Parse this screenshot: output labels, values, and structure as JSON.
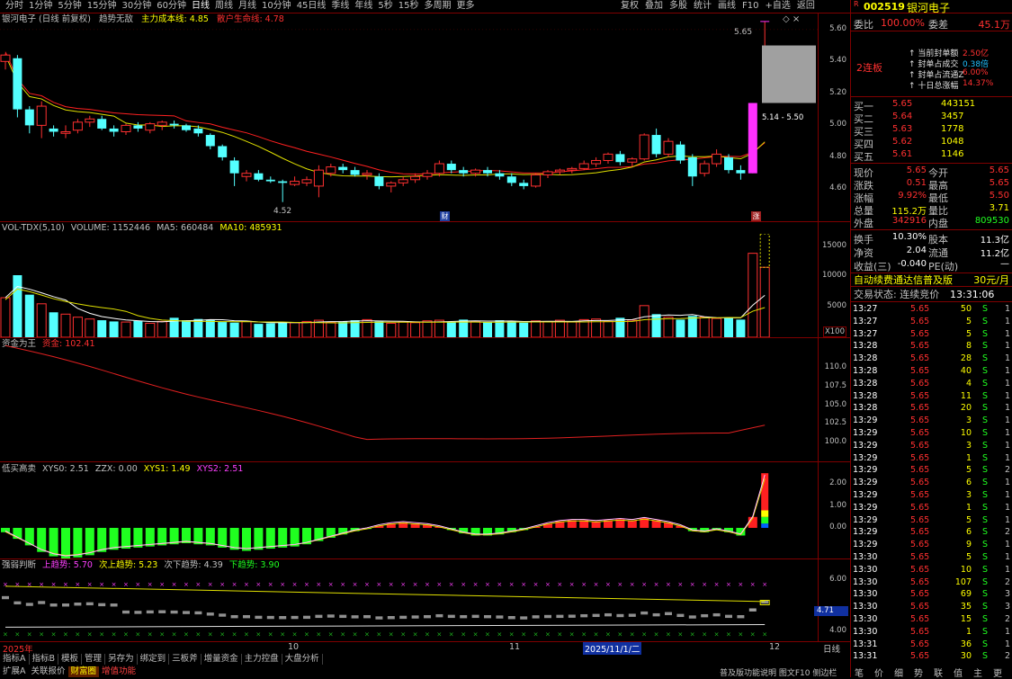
{
  "toolbar": {
    "periods": [
      "分时",
      "1分钟",
      "5分钟",
      "15分钟",
      "30分钟",
      "60分钟",
      "日线",
      "周线",
      "月线",
      "10分钟",
      "45日线",
      "季线",
      "年线",
      "5秒",
      "15秒",
      "多周期",
      "更多"
    ],
    "active_index": 6,
    "right_buttons": [
      "复权",
      "叠加",
      "多股",
      "统计",
      "画线",
      "F10",
      "+自选",
      "返回"
    ]
  },
  "main_header": {
    "name": "银河电子 (日线 前复权)",
    "indicator": "趋势无敌",
    "l1": "主力成本线: 4.85",
    "l2": "散户生命线: 4.78"
  },
  "main_axis": [
    "5.60",
    "5.40",
    "5.20",
    "5.00",
    "4.80",
    "4.60"
  ],
  "annot": {
    "high": "5.65",
    "low": "4.52",
    "range": "5.14 - 5.50",
    "cai": "财",
    "zhang": "涨"
  },
  "vol_header": {
    "name": "VOL-TDX(5,10)",
    "volume": "VOLUME: 1152446",
    "ma5": "MA5: 660484",
    "ma10": "MA10: 485931"
  },
  "vol_axis": [
    "15000",
    "10000",
    "5000"
  ],
  "vol_unit": "X100",
  "cap_header": {
    "name": "资金为王",
    "label": "资金: 102.41"
  },
  "cap_axis": [
    "110.0",
    "107.5",
    "105.0",
    "102.5",
    "100.0"
  ],
  "low_header": {
    "name": "低买高卖",
    "xys0": "XYS0: 2.51",
    "zzx": "ZZX: 0.00",
    "xys1": "XYS1: 1.49",
    "xys2": "XYS2: 2.51"
  },
  "low_axis": [
    "2.00",
    "1.00",
    "0.00"
  ],
  "strong_header": {
    "name": "强弱判断",
    "a": "上趋势: 5.70",
    "b": "次上趋势: 5.23",
    "c": "次下趋势: 4.39",
    "d": "下趋势: 3.90"
  },
  "strong_axis": [
    "6.00",
    "4.00"
  ],
  "strong_tag": "4.71",
  "date_axis": {
    "d1": "2025年",
    "d2": "10",
    "d3": "11",
    "d4": "2025/11/1/二",
    "d5": "12",
    "right": "日线"
  },
  "bottom_tabs": [
    "指标A",
    "指标B",
    "模板",
    "管理",
    "另存为",
    "绑定到",
    "三板斧",
    "增量资金",
    "主力控盘",
    "大盘分析"
  ],
  "bottom_tabs2": [
    "扩展A",
    "关联报价",
    "财富圈",
    "增值功能"
  ],
  "status_bar": "普及版功能说明 图文F10 侧边栏",
  "right": {
    "code": "002519",
    "name": "银河电子",
    "weibi_l": "委比",
    "weibi": "100.00%",
    "weicha_l": "委差",
    "weicha": "45.1万",
    "lianban": "2连板",
    "fd": [
      [
        "当前封单额",
        "2.50亿"
      ],
      [
        "封单占成交",
        "0.38倍"
      ],
      [
        "封单占流通Z",
        "6.00%"
      ],
      [
        "十日总涨幅",
        "14.37%"
      ]
    ],
    "bids": [
      [
        "买一",
        "5.65",
        "443151"
      ],
      [
        "买二",
        "5.64",
        "3457"
      ],
      [
        "买三",
        "5.63",
        "1778"
      ],
      [
        "买四",
        "5.62",
        "1048"
      ],
      [
        "买五",
        "5.61",
        "1146"
      ]
    ],
    "stats": [
      [
        "现价",
        "5.65",
        "今开",
        "5.65"
      ],
      [
        "涨跌",
        "0.51",
        "最高",
        "5.65"
      ],
      [
        "涨幅",
        "9.92%",
        "最低",
        "5.50"
      ],
      [
        "总量",
        "115.2万",
        "量比",
        "3.71"
      ],
      [
        "外盘",
        "342916",
        "内盘",
        "809530"
      ]
    ],
    "stats2": [
      [
        "换手",
        "10.30%",
        "股本",
        "11.3亿"
      ],
      [
        "净资",
        "2.04",
        "流通",
        "11.2亿"
      ],
      [
        "收益(三)",
        "-0.040",
        "PE(动)",
        "—"
      ]
    ],
    "banner": "自动续费通达信普及版",
    "banner_price": "30元/月",
    "trade_state": "交易状态: 连续竞价",
    "trade_time": "13:31:06",
    "ticks": [
      [
        "13:27",
        "5.65",
        "50",
        "S",
        "1"
      ],
      [
        "13:27",
        "5.65",
        "5",
        "S",
        "1"
      ],
      [
        "13:27",
        "5.65",
        "5",
        "S",
        "1"
      ],
      [
        "13:28",
        "5.65",
        "8",
        "S",
        "1"
      ],
      [
        "13:28",
        "5.65",
        "28",
        "S",
        "1"
      ],
      [
        "13:28",
        "5.65",
        "40",
        "S",
        "1"
      ],
      [
        "13:28",
        "5.65",
        "4",
        "S",
        "1"
      ],
      [
        "13:28",
        "5.65",
        "11",
        "S",
        "1"
      ],
      [
        "13:28",
        "5.65",
        "20",
        "S",
        "1"
      ],
      [
        "13:29",
        "5.65",
        "3",
        "S",
        "1"
      ],
      [
        "13:29",
        "5.65",
        "10",
        "S",
        "1"
      ],
      [
        "13:29",
        "5.65",
        "3",
        "S",
        "1"
      ],
      [
        "13:29",
        "5.65",
        "1",
        "S",
        "1"
      ],
      [
        "13:29",
        "5.65",
        "5",
        "S",
        "2"
      ],
      [
        "13:29",
        "5.65",
        "6",
        "S",
        "1"
      ],
      [
        "13:29",
        "5.65",
        "3",
        "S",
        "1"
      ],
      [
        "13:29",
        "5.65",
        "1",
        "S",
        "1"
      ],
      [
        "13:29",
        "5.65",
        "5",
        "S",
        "1"
      ],
      [
        "13:29",
        "5.65",
        "6",
        "S",
        "2"
      ],
      [
        "13:29",
        "5.65",
        "9",
        "S",
        "1"
      ],
      [
        "13:30",
        "5.65",
        "5",
        "S",
        "1"
      ],
      [
        "13:30",
        "5.65",
        "10",
        "S",
        "1"
      ],
      [
        "13:30",
        "5.65",
        "107",
        "S",
        "2"
      ],
      [
        "13:30",
        "5.65",
        "69",
        "S",
        "3"
      ],
      [
        "13:30",
        "5.65",
        "35",
        "S",
        "3"
      ],
      [
        "13:30",
        "5.65",
        "15",
        "S",
        "2"
      ],
      [
        "13:30",
        "5.65",
        "1",
        "S",
        "1"
      ],
      [
        "13:31",
        "5.65",
        "36",
        "S",
        "1"
      ],
      [
        "13:31",
        "5.65",
        "30",
        "S",
        "2"
      ]
    ],
    "bottom_tabs": [
      "笔",
      "价",
      "细",
      "势",
      "联",
      "值",
      "主",
      "更"
    ]
  },
  "chart_data": [
    {
      "type": "candlestick",
      "title": "银河电子 (日线 前复权)",
      "ylim": [
        4.4,
        5.7
      ],
      "candles": [
        [
          5.4,
          5.45,
          5.35,
          5.44
        ],
        [
          5.42,
          5.44,
          5.05,
          5.1
        ],
        [
          5.1,
          5.12,
          4.95,
          5.0
        ],
        [
          5.0,
          5.15,
          4.92,
          5.12
        ],
        [
          4.98,
          5.0,
          4.93,
          4.96
        ],
        [
          4.95,
          5.0,
          4.92,
          4.96
        ],
        [
          4.97,
          5.04,
          4.95,
          5.02
        ],
        [
          5.02,
          5.06,
          4.99,
          5.04
        ],
        [
          5.04,
          5.06,
          4.97,
          4.98
        ],
        [
          4.98,
          5.0,
          4.93,
          4.96
        ],
        [
          4.96,
          5.01,
          4.94,
          5.0
        ],
        [
          5.0,
          5.02,
          4.96,
          4.98
        ],
        [
          4.97,
          5.02,
          4.95,
          5.01
        ],
        [
          5.0,
          5.03,
          4.97,
          5.02
        ],
        [
          5.01,
          5.03,
          4.98,
          5.0
        ],
        [
          5.0,
          5.01,
          4.96,
          4.97
        ],
        [
          4.98,
          5.0,
          4.93,
          4.95
        ],
        [
          4.94,
          4.95,
          4.85,
          4.87
        ],
        [
          4.87,
          4.88,
          4.78,
          4.8
        ],
        [
          4.78,
          4.8,
          4.62,
          4.7
        ],
        [
          4.68,
          4.72,
          4.65,
          4.7
        ],
        [
          4.7,
          4.72,
          4.65,
          4.66
        ],
        [
          4.66,
          4.68,
          4.64,
          4.65
        ],
        [
          4.65,
          4.66,
          4.52,
          4.64
        ],
        [
          4.63,
          4.68,
          4.62,
          4.65
        ],
        [
          4.64,
          4.68,
          4.62,
          4.66
        ],
        [
          4.62,
          4.75,
          4.55,
          4.72
        ],
        [
          4.7,
          4.76,
          4.68,
          4.74
        ],
        [
          4.74,
          4.76,
          4.7,
          4.72
        ],
        [
          4.72,
          4.74,
          4.68,
          4.69
        ],
        [
          4.69,
          4.72,
          4.66,
          4.7
        ],
        [
          4.68,
          4.7,
          4.6,
          4.62
        ],
        [
          4.62,
          4.65,
          4.58,
          4.64
        ],
        [
          4.64,
          4.68,
          4.62,
          4.66
        ],
        [
          4.66,
          4.7,
          4.64,
          4.68
        ],
        [
          4.68,
          4.72,
          4.66,
          4.7
        ],
        [
          4.7,
          4.78,
          4.68,
          4.76
        ],
        [
          4.76,
          4.78,
          4.7,
          4.72
        ],
        [
          4.72,
          4.74,
          4.68,
          4.7
        ],
        [
          4.7,
          4.73,
          4.68,
          4.72
        ],
        [
          4.72,
          4.74,
          4.68,
          4.7
        ],
        [
          4.7,
          4.72,
          4.66,
          4.68
        ],
        [
          4.68,
          4.7,
          4.62,
          4.64
        ],
        [
          4.64,
          4.66,
          4.6,
          4.62
        ],
        [
          4.62,
          4.7,
          4.61,
          4.69
        ],
        [
          4.69,
          4.72,
          4.67,
          4.71
        ],
        [
          4.71,
          4.73,
          4.69,
          4.72
        ],
        [
          4.72,
          4.74,
          4.7,
          4.73
        ],
        [
          4.73,
          4.78,
          4.72,
          4.76
        ],
        [
          4.76,
          4.8,
          4.74,
          4.78
        ],
        [
          4.78,
          4.83,
          4.76,
          4.82
        ],
        [
          4.82,
          4.84,
          4.75,
          4.77
        ],
        [
          4.77,
          4.8,
          4.74,
          4.79
        ],
        [
          4.79,
          4.95,
          4.78,
          4.94
        ],
        [
          4.94,
          4.98,
          4.8,
          4.82
        ],
        [
          4.82,
          4.92,
          4.8,
          4.9
        ],
        [
          4.88,
          4.9,
          4.76,
          4.78
        ],
        [
          4.8,
          4.82,
          4.62,
          4.68
        ],
        [
          4.7,
          4.78,
          4.68,
          4.76
        ],
        [
          4.76,
          4.85,
          4.74,
          4.82
        ],
        [
          4.8,
          4.82,
          4.7,
          4.72
        ],
        [
          4.72,
          4.75,
          4.66,
          4.7
        ],
        [
          4.7,
          5.14,
          4.7,
          5.14
        ],
        [
          5.14,
          5.65,
          5.5,
          5.65
        ]
      ]
    }
  ]
}
